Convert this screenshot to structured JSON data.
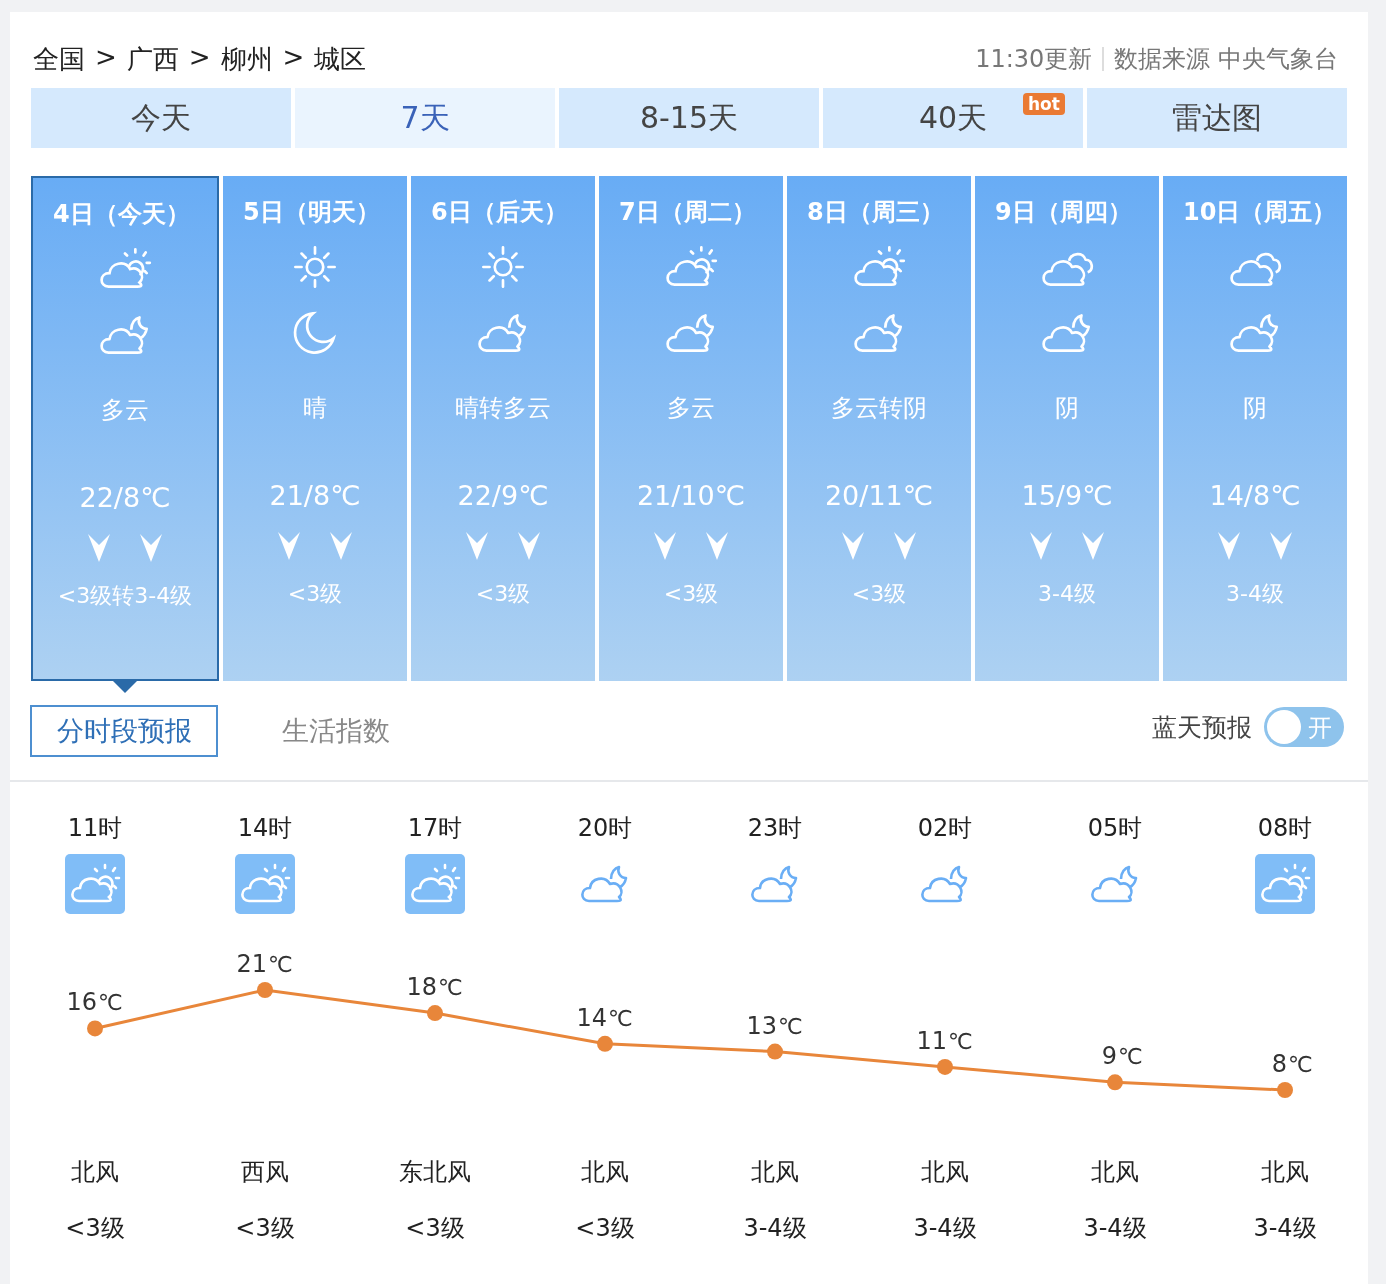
{
  "breadcrumb": [
    "全国",
    "广西",
    "柳州",
    "城区"
  ],
  "breadcrumb_separator": ">",
  "update_time": "11:30更新",
  "source": "数据来源 中央气象台",
  "tabs": [
    {
      "label": "今天",
      "selected": false
    },
    {
      "label": "7天",
      "selected": true
    },
    {
      "label": "8-15天",
      "selected": false
    },
    {
      "label": "40天",
      "selected": false,
      "badge": "hot"
    },
    {
      "label": "雷达图",
      "selected": false
    }
  ],
  "days": [
    {
      "date": "4日（今天）",
      "icons": [
        {
          "kind": "cloudsun"
        },
        {
          "kind": "cloudmoon"
        }
      ],
      "weather": "多云",
      "temp": "22/8℃",
      "wind": "<3级转3-4级",
      "selected": true
    },
    {
      "date": "5日（明天）",
      "icons": [
        {
          "kind": "sun"
        },
        {
          "kind": "moon"
        }
      ],
      "weather": "晴",
      "temp": "21/8℃",
      "wind": "<3级",
      "selected": false
    },
    {
      "date": "6日（后天）",
      "icons": [
        {
          "kind": "sun"
        },
        {
          "kind": "cloudmoon"
        }
      ],
      "weather": "晴转多云",
      "temp": "22/9℃",
      "wind": "<3级",
      "selected": false
    },
    {
      "date": "7日（周二）",
      "icons": [
        {
          "kind": "cloudsun"
        },
        {
          "kind": "cloudmoon"
        }
      ],
      "weather": "多云",
      "temp": "21/10℃",
      "wind": "<3级",
      "selected": false
    },
    {
      "date": "8日（周三）",
      "icons": [
        {
          "kind": "cloudsun"
        },
        {
          "kind": "cloudmoon"
        }
      ],
      "weather": "多云转阴",
      "temp": "20/11℃",
      "wind": "<3级",
      "selected": false
    },
    {
      "date": "9日（周四）",
      "icons": [
        {
          "kind": "clouds"
        },
        {
          "kind": "cloudmoon"
        }
      ],
      "weather": "阴",
      "temp": "15/9℃",
      "wind": "3-4级",
      "selected": false
    },
    {
      "date": "10日（周五）",
      "icons": [
        {
          "kind": "clouds"
        },
        {
          "kind": "cloudmoon"
        }
      ],
      "weather": "阴",
      "temp": "14/8℃",
      "wind": "3-4级",
      "selected": false
    }
  ],
  "subtabs": [
    {
      "label": "分时段预报",
      "selected": true
    },
    {
      "label": "生活指数",
      "selected": false
    }
  ],
  "blue_sky": {
    "label": "蓝天预报",
    "toggle_text": "开",
    "on": false
  },
  "hourly": {
    "hours": [
      {
        "kind": "cloudsun",
        "direction": "北风",
        "wind": "<3级"
      },
      {
        "kind": "cloudsun",
        "direction": "西风",
        "wind": "<3级"
      },
      {
        "kind": "cloudsun",
        "direction": "东北风",
        "wind": "<3级"
      },
      {
        "kind": "cloudmoon",
        "direction": "北风",
        "wind": "<3级"
      },
      {
        "kind": "cloudmoon",
        "direction": "北风",
        "wind": "3-4级"
      },
      {
        "kind": "cloudmoon",
        "direction": "北风",
        "wind": "3-4级"
      },
      {
        "kind": "cloudmoon",
        "direction": "北风",
        "wind": "3-4级"
      },
      {
        "kind": "cloudsun",
        "direction": "北风",
        "wind": "3-4级"
      }
    ],
    "chart_data": {
      "type": "line",
      "categories": [
        "11时",
        "14时",
        "17时",
        "20时",
        "23时",
        "02时",
        "05时",
        "08时"
      ],
      "series": [
        {
          "color": "#e8863a",
          "marker": "circle",
          "values": [
            16,
            21,
            18,
            14,
            13,
            11,
            9,
            8
          ]
        }
      ],
      "ylabel": "℃",
      "data_labels": true
    }
  }
}
